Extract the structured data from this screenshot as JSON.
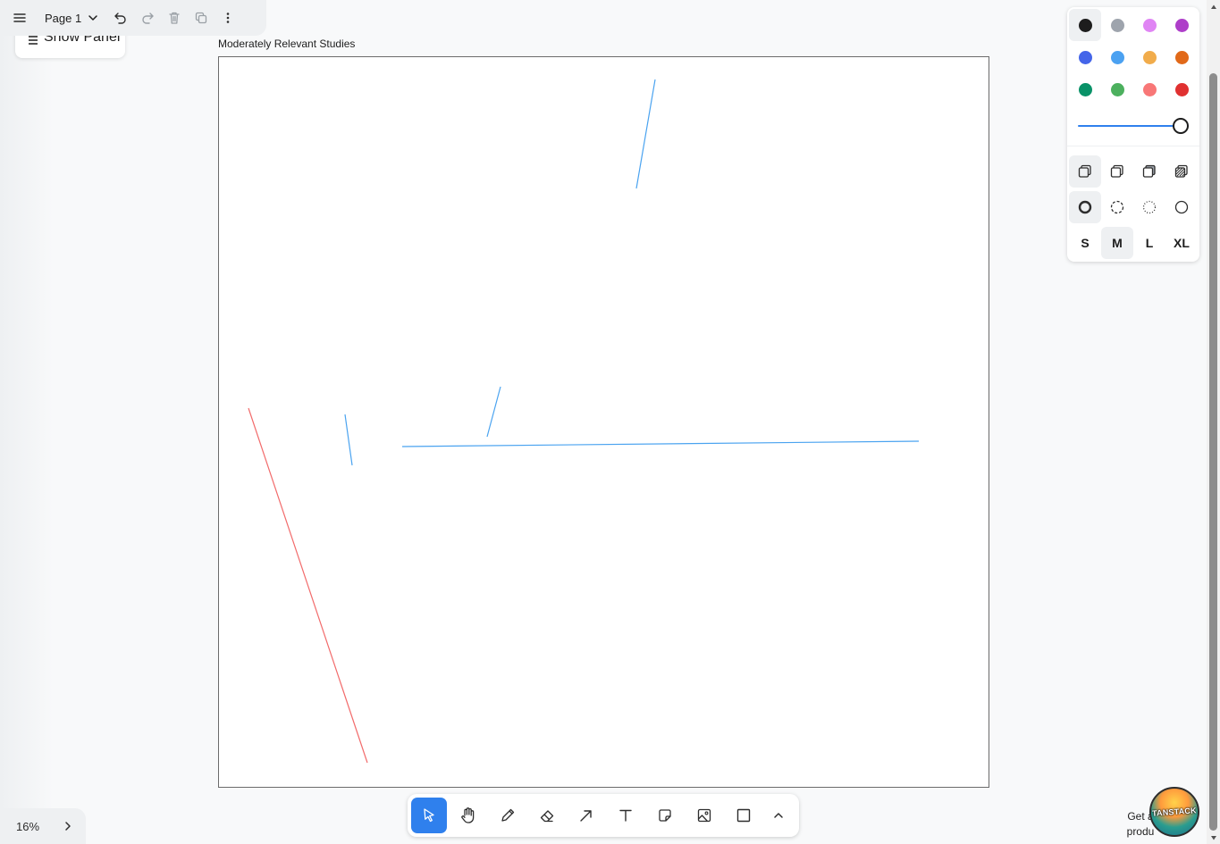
{
  "topbar": {
    "page_label": "Page 1"
  },
  "show_panel": {
    "label": "Show Panel"
  },
  "frame": {
    "title": "Moderately Relevant Studies"
  },
  "drawing": {
    "shapes": [
      {
        "kind": "line",
        "color": "#4aa3f0"
      },
      {
        "kind": "line",
        "color": "#4aa3f0"
      },
      {
        "kind": "line",
        "color": "#4aa3f0"
      },
      {
        "kind": "line",
        "color": "#4aa3f0"
      },
      {
        "kind": "line",
        "color": "#f26b6b"
      }
    ]
  },
  "style_panel": {
    "colors": [
      {
        "name": "black",
        "hex": "#1d1d1d",
        "selected": true
      },
      {
        "name": "grey",
        "hex": "#9ea4ad",
        "selected": false
      },
      {
        "name": "light-violet",
        "hex": "#e085f4",
        "selected": false
      },
      {
        "name": "violet",
        "hex": "#ae3ec9",
        "selected": false
      },
      {
        "name": "blue",
        "hex": "#4465e9",
        "selected": false
      },
      {
        "name": "light-blue",
        "hex": "#4ba1f1",
        "selected": false
      },
      {
        "name": "yellow",
        "hex": "#f1ac4b",
        "selected": false
      },
      {
        "name": "orange",
        "hex": "#e16919",
        "selected": false
      },
      {
        "name": "green",
        "hex": "#099268",
        "selected": false
      },
      {
        "name": "light-green",
        "hex": "#4cb05e",
        "selected": false
      },
      {
        "name": "light-red",
        "hex": "#f87777",
        "selected": false
      },
      {
        "name": "red",
        "hex": "#e03131",
        "selected": false
      }
    ],
    "opacity": 1.0,
    "fills": [
      "fill-none-icon",
      "fill-semi-icon",
      "fill-solid-icon",
      "fill-pattern-icon"
    ],
    "dashes": [
      "dash-draw-icon",
      "dash-dashed-icon",
      "dash-dotted-icon",
      "dash-solid-icon"
    ],
    "sizes": [
      "S",
      "M",
      "L",
      "XL"
    ],
    "selected_size": "M"
  },
  "toolbar": {
    "tools": [
      "select-tool",
      "hand-tool",
      "draw-tool",
      "eraser-tool",
      "arrow-tool",
      "text-tool",
      "note-tool",
      "asset-tool",
      "rectangle-tool",
      "more-tools"
    ],
    "active": "select-tool"
  },
  "zoom": {
    "level": "16%"
  },
  "promo": {
    "line1": "Get a",
    "line2": "produ",
    "badge": "TANSTACK"
  }
}
